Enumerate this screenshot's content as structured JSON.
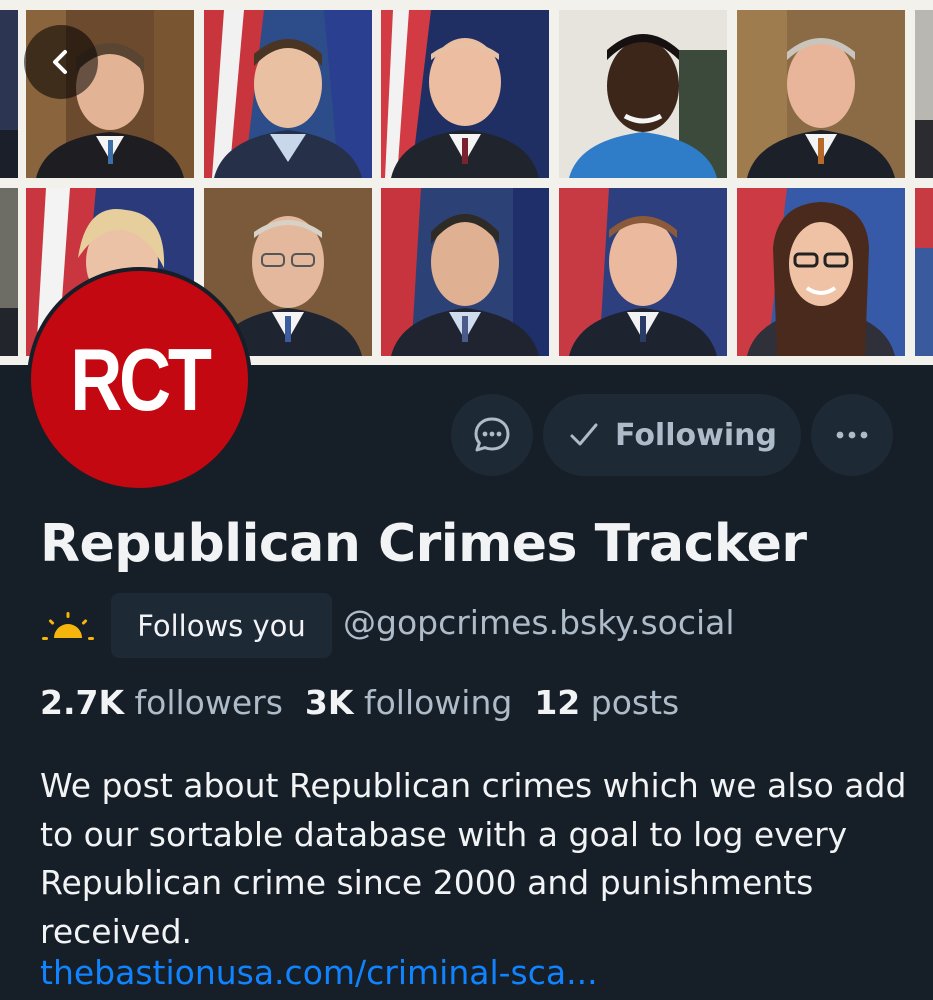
{
  "header": {
    "back_label": "Back"
  },
  "avatar": {
    "text": "RCT",
    "color": "#c40811"
  },
  "actions": {
    "following_label": "Following"
  },
  "profile": {
    "display_name": "Republican Crimes Tracker",
    "follows_badge": "Follows you",
    "handle": "@gopcrimes.bsky.social"
  },
  "stats": {
    "followers_count": "2.7K",
    "followers_label": "followers",
    "following_count": "3K",
    "following_label": "following",
    "posts_count": "12",
    "posts_label": "posts"
  },
  "bio": {
    "text": "We post about Republican crimes which we also add to our sortable database with a goal to log every Republican crime since 2000 and punishments received.",
    "link": "thebastionusa.com/criminal-sca..."
  },
  "colors": {
    "background": "#161e27",
    "button_bg": "#1e2936",
    "text_primary": "#f1f3f5",
    "text_secondary": "#aebbc9",
    "link": "#1083fe",
    "banner_bg": "#f3f1ec"
  },
  "icons": {
    "back": "chevron-left-icon",
    "message": "chat-bubble-icon",
    "following": "checkmark-icon",
    "more": "ellipsis-icon",
    "moderation": "sun-icon"
  }
}
